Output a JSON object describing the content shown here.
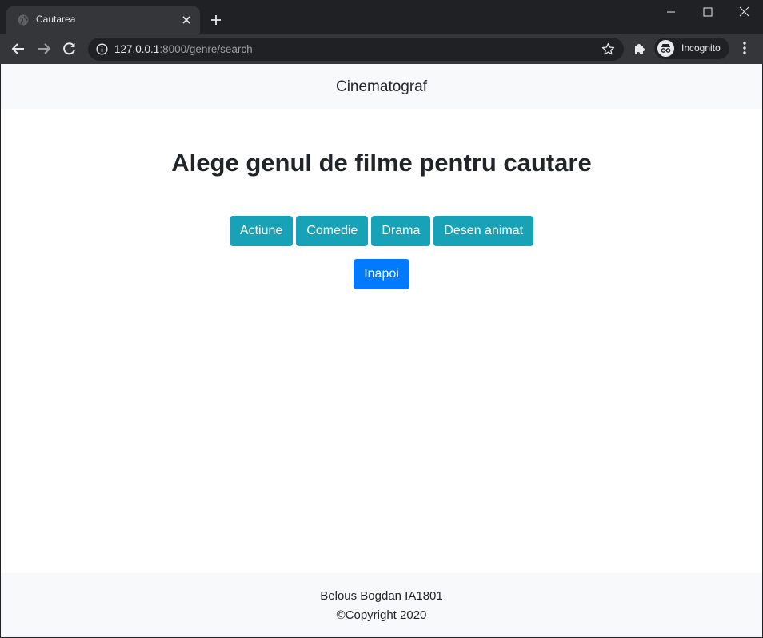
{
  "browser": {
    "tab_title": "Cautarea",
    "url_host": "127.0.0.1",
    "url_rest": ":8000/genre/search",
    "profile_label": "Incognito"
  },
  "page": {
    "brand": "Cinematograf",
    "heading": "Alege genul de filme pentru cautare",
    "genres": [
      {
        "label": "Actiune"
      },
      {
        "label": "Comedie"
      },
      {
        "label": "Drama"
      },
      {
        "label": "Desen animat"
      }
    ],
    "back_label": "Inapoi",
    "footer": {
      "author": "Belous Bogdan IA1801",
      "copyright": "©Copyright 2020"
    }
  },
  "colors": {
    "genre_button": "#17a2b8",
    "back_button": "#007bff",
    "navbar_bg": "#f8f9fa"
  }
}
